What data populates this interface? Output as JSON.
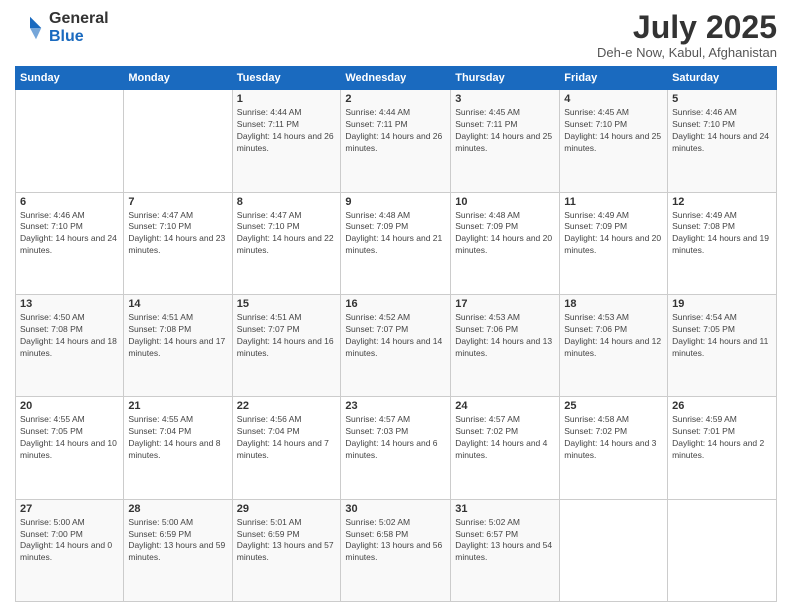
{
  "logo": {
    "general": "General",
    "blue": "Blue"
  },
  "title": "July 2025",
  "subtitle": "Deh-e Now, Kabul, Afghanistan",
  "weekdays": [
    "Sunday",
    "Monday",
    "Tuesday",
    "Wednesday",
    "Thursday",
    "Friday",
    "Saturday"
  ],
  "weeks": [
    [
      {
        "day": "",
        "sunrise": "",
        "sunset": "",
        "daylight": ""
      },
      {
        "day": "",
        "sunrise": "",
        "sunset": "",
        "daylight": ""
      },
      {
        "day": "1",
        "sunrise": "Sunrise: 4:44 AM",
        "sunset": "Sunset: 7:11 PM",
        "daylight": "Daylight: 14 hours and 26 minutes."
      },
      {
        "day": "2",
        "sunrise": "Sunrise: 4:44 AM",
        "sunset": "Sunset: 7:11 PM",
        "daylight": "Daylight: 14 hours and 26 minutes."
      },
      {
        "day": "3",
        "sunrise": "Sunrise: 4:45 AM",
        "sunset": "Sunset: 7:11 PM",
        "daylight": "Daylight: 14 hours and 25 minutes."
      },
      {
        "day": "4",
        "sunrise": "Sunrise: 4:45 AM",
        "sunset": "Sunset: 7:10 PM",
        "daylight": "Daylight: 14 hours and 25 minutes."
      },
      {
        "day": "5",
        "sunrise": "Sunrise: 4:46 AM",
        "sunset": "Sunset: 7:10 PM",
        "daylight": "Daylight: 14 hours and 24 minutes."
      }
    ],
    [
      {
        "day": "6",
        "sunrise": "Sunrise: 4:46 AM",
        "sunset": "Sunset: 7:10 PM",
        "daylight": "Daylight: 14 hours and 24 minutes."
      },
      {
        "day": "7",
        "sunrise": "Sunrise: 4:47 AM",
        "sunset": "Sunset: 7:10 PM",
        "daylight": "Daylight: 14 hours and 23 minutes."
      },
      {
        "day": "8",
        "sunrise": "Sunrise: 4:47 AM",
        "sunset": "Sunset: 7:10 PM",
        "daylight": "Daylight: 14 hours and 22 minutes."
      },
      {
        "day": "9",
        "sunrise": "Sunrise: 4:48 AM",
        "sunset": "Sunset: 7:09 PM",
        "daylight": "Daylight: 14 hours and 21 minutes."
      },
      {
        "day": "10",
        "sunrise": "Sunrise: 4:48 AM",
        "sunset": "Sunset: 7:09 PM",
        "daylight": "Daylight: 14 hours and 20 minutes."
      },
      {
        "day": "11",
        "sunrise": "Sunrise: 4:49 AM",
        "sunset": "Sunset: 7:09 PM",
        "daylight": "Daylight: 14 hours and 20 minutes."
      },
      {
        "day": "12",
        "sunrise": "Sunrise: 4:49 AM",
        "sunset": "Sunset: 7:08 PM",
        "daylight": "Daylight: 14 hours and 19 minutes."
      }
    ],
    [
      {
        "day": "13",
        "sunrise": "Sunrise: 4:50 AM",
        "sunset": "Sunset: 7:08 PM",
        "daylight": "Daylight: 14 hours and 18 minutes."
      },
      {
        "day": "14",
        "sunrise": "Sunrise: 4:51 AM",
        "sunset": "Sunset: 7:08 PM",
        "daylight": "Daylight: 14 hours and 17 minutes."
      },
      {
        "day": "15",
        "sunrise": "Sunrise: 4:51 AM",
        "sunset": "Sunset: 7:07 PM",
        "daylight": "Daylight: 14 hours and 16 minutes."
      },
      {
        "day": "16",
        "sunrise": "Sunrise: 4:52 AM",
        "sunset": "Sunset: 7:07 PM",
        "daylight": "Daylight: 14 hours and 14 minutes."
      },
      {
        "day": "17",
        "sunrise": "Sunrise: 4:53 AM",
        "sunset": "Sunset: 7:06 PM",
        "daylight": "Daylight: 14 hours and 13 minutes."
      },
      {
        "day": "18",
        "sunrise": "Sunrise: 4:53 AM",
        "sunset": "Sunset: 7:06 PM",
        "daylight": "Daylight: 14 hours and 12 minutes."
      },
      {
        "day": "19",
        "sunrise": "Sunrise: 4:54 AM",
        "sunset": "Sunset: 7:05 PM",
        "daylight": "Daylight: 14 hours and 11 minutes."
      }
    ],
    [
      {
        "day": "20",
        "sunrise": "Sunrise: 4:55 AM",
        "sunset": "Sunset: 7:05 PM",
        "daylight": "Daylight: 14 hours and 10 minutes."
      },
      {
        "day": "21",
        "sunrise": "Sunrise: 4:55 AM",
        "sunset": "Sunset: 7:04 PM",
        "daylight": "Daylight: 14 hours and 8 minutes."
      },
      {
        "day": "22",
        "sunrise": "Sunrise: 4:56 AM",
        "sunset": "Sunset: 7:04 PM",
        "daylight": "Daylight: 14 hours and 7 minutes."
      },
      {
        "day": "23",
        "sunrise": "Sunrise: 4:57 AM",
        "sunset": "Sunset: 7:03 PM",
        "daylight": "Daylight: 14 hours and 6 minutes."
      },
      {
        "day": "24",
        "sunrise": "Sunrise: 4:57 AM",
        "sunset": "Sunset: 7:02 PM",
        "daylight": "Daylight: 14 hours and 4 minutes."
      },
      {
        "day": "25",
        "sunrise": "Sunrise: 4:58 AM",
        "sunset": "Sunset: 7:02 PM",
        "daylight": "Daylight: 14 hours and 3 minutes."
      },
      {
        "day": "26",
        "sunrise": "Sunrise: 4:59 AM",
        "sunset": "Sunset: 7:01 PM",
        "daylight": "Daylight: 14 hours and 2 minutes."
      }
    ],
    [
      {
        "day": "27",
        "sunrise": "Sunrise: 5:00 AM",
        "sunset": "Sunset: 7:00 PM",
        "daylight": "Daylight: 14 hours and 0 minutes."
      },
      {
        "day": "28",
        "sunrise": "Sunrise: 5:00 AM",
        "sunset": "Sunset: 6:59 PM",
        "daylight": "Daylight: 13 hours and 59 minutes."
      },
      {
        "day": "29",
        "sunrise": "Sunrise: 5:01 AM",
        "sunset": "Sunset: 6:59 PM",
        "daylight": "Daylight: 13 hours and 57 minutes."
      },
      {
        "day": "30",
        "sunrise": "Sunrise: 5:02 AM",
        "sunset": "Sunset: 6:58 PM",
        "daylight": "Daylight: 13 hours and 56 minutes."
      },
      {
        "day": "31",
        "sunrise": "Sunrise: 5:02 AM",
        "sunset": "Sunset: 6:57 PM",
        "daylight": "Daylight: 13 hours and 54 minutes."
      },
      {
        "day": "",
        "sunrise": "",
        "sunset": "",
        "daylight": ""
      },
      {
        "day": "",
        "sunrise": "",
        "sunset": "",
        "daylight": ""
      }
    ]
  ]
}
